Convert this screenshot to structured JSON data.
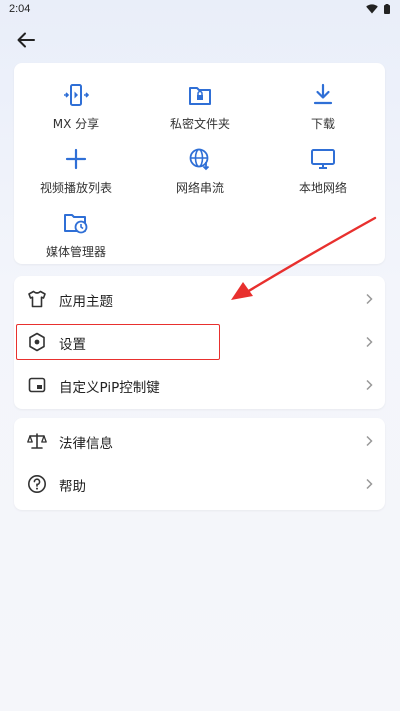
{
  "status_bar": {
    "time": "2:04"
  },
  "grid": {
    "items": [
      {
        "label": "MX 分享",
        "icon": "mx-share-icon"
      },
      {
        "label": "私密文件夹",
        "icon": "private-folder-icon"
      },
      {
        "label": "下载",
        "icon": "download-icon"
      },
      {
        "label": "视频播放列表",
        "icon": "video-playlist-icon"
      },
      {
        "label": "网络串流",
        "icon": "network-stream-icon"
      },
      {
        "label": "本地网络",
        "icon": "local-network-icon"
      },
      {
        "label": "媒体管理器",
        "icon": "media-manager-icon"
      }
    ]
  },
  "menu1": {
    "items": [
      {
        "label": "应用主题",
        "icon": "tshirt-icon"
      },
      {
        "label": "设置",
        "icon": "settings-hexagon-icon"
      },
      {
        "label": "自定义PiP控制键",
        "icon": "pip-icon"
      }
    ]
  },
  "menu2": {
    "items": [
      {
        "label": "法律信息",
        "icon": "scales-icon"
      },
      {
        "label": "帮助",
        "icon": "help-icon"
      }
    ]
  },
  "colors": {
    "accent": "#2f6fd6",
    "annotation": "#e8302e"
  }
}
